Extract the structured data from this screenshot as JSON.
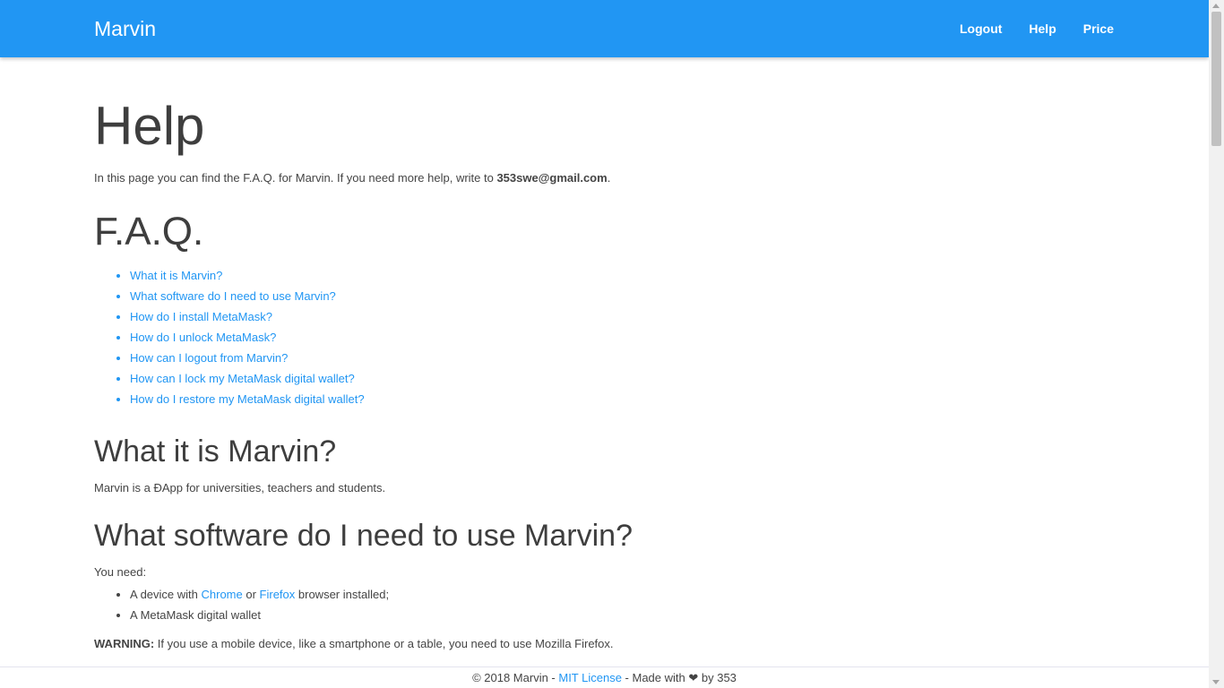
{
  "navbar": {
    "brand": "Marvin",
    "links": [
      "Logout",
      "Help",
      "Price"
    ]
  },
  "page": {
    "title": "Help",
    "intro_text": "In this page you can find the F.A.Q. for Marvin. If you need more help, write to ",
    "intro_email": "353swe@gmail.com",
    "intro_end": "."
  },
  "faq": {
    "title": "F.A.Q.",
    "items": [
      "What it is Marvin?",
      "What software do I need to use Marvin?",
      "How do I install MetaMask?",
      "How do I unlock MetaMask?",
      "How can I logout from Marvin?",
      "How can I lock my MetaMask digital wallet?",
      "How do I restore my MetaMask digital wallet?"
    ]
  },
  "section_what": {
    "title": "What it is Marvin?",
    "body": "Marvin is a ĐApp for universities, teachers and students."
  },
  "section_software": {
    "title": "What software do I need to use Marvin?",
    "lead": "You need:",
    "item1_prefix": "A device with ",
    "item1_link1": "Chrome",
    "item1_or": " or ",
    "item1_link2": "Firefox",
    "item1_suffix": " browser installed;",
    "item2": "A MetaMask digital wallet",
    "warning_label": "WARNING:",
    "warning_text": " If you use a mobile device, like a smartphone or a table, you need to use Mozilla Firefox."
  },
  "footer": {
    "copyright": "© 2018 Marvin - ",
    "license_link": "MIT License",
    "made_with": " - Made with ",
    "heart_icon": "heart-icon",
    "by": " by 353"
  }
}
